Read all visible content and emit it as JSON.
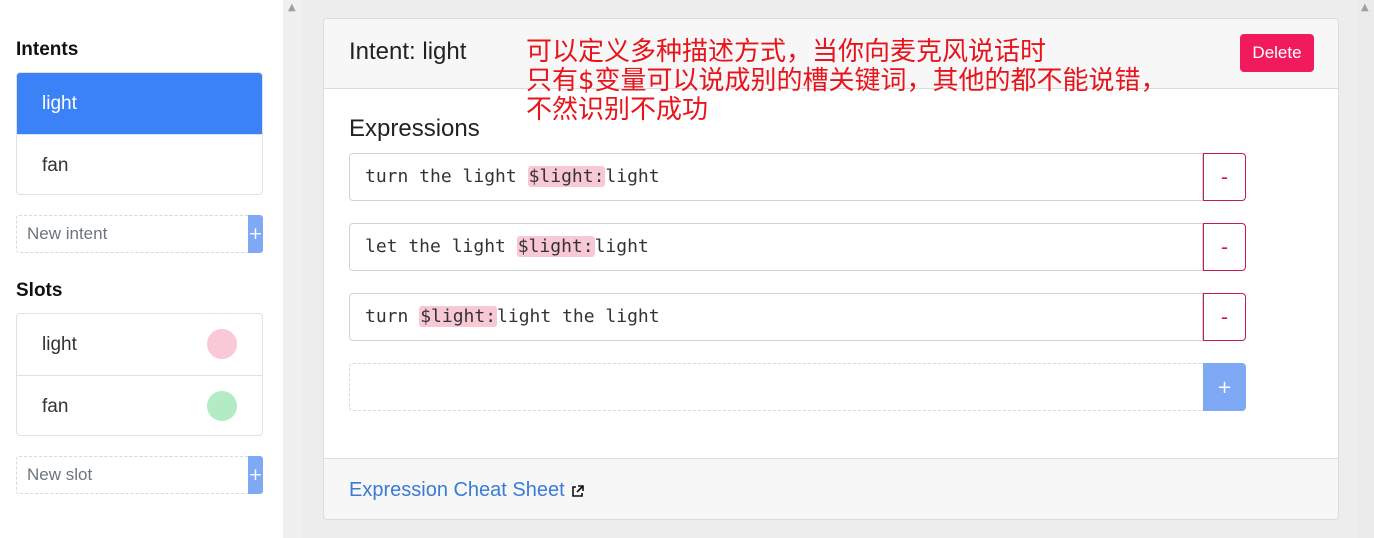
{
  "sidebar": {
    "intents_title": "Intents",
    "intents": [
      {
        "label": "light",
        "active": true
      },
      {
        "label": "fan",
        "active": false
      }
    ],
    "new_intent_placeholder": "New intent",
    "add_symbol": "+",
    "slots_title": "Slots",
    "slots": [
      {
        "label": "light",
        "color": "#f9c9d6"
      },
      {
        "label": "fan",
        "color": "#b3ebc4"
      }
    ],
    "new_slot_placeholder": "New slot"
  },
  "main": {
    "title": "Intent: light",
    "delete_label": "Delete",
    "annotation_lines": [
      "可以定义多种描述方式，当你向麦克风说话时",
      "只有$变量可以说成别的槽关键词，其他的都不能说错，",
      "不然识别不成功"
    ],
    "expressions_title": "Expressions",
    "expressions": [
      {
        "before": "turn the light ",
        "slot": "$light:",
        "after": "light"
      },
      {
        "before": "let the light ",
        "slot": "$light:",
        "after": "light"
      },
      {
        "before": "turn ",
        "slot": "$light:",
        "after": "light the light"
      }
    ],
    "remove_symbol": "-",
    "add_symbol": "+",
    "cheat_sheet_label": "Expression Cheat Sheet"
  },
  "colors": {
    "accent": "#3b82f6",
    "add_button": "#7fa9f5",
    "delete_button": "#f01a5d",
    "slot_highlight": "#f8c8d4",
    "annotation": "#e8141b"
  }
}
